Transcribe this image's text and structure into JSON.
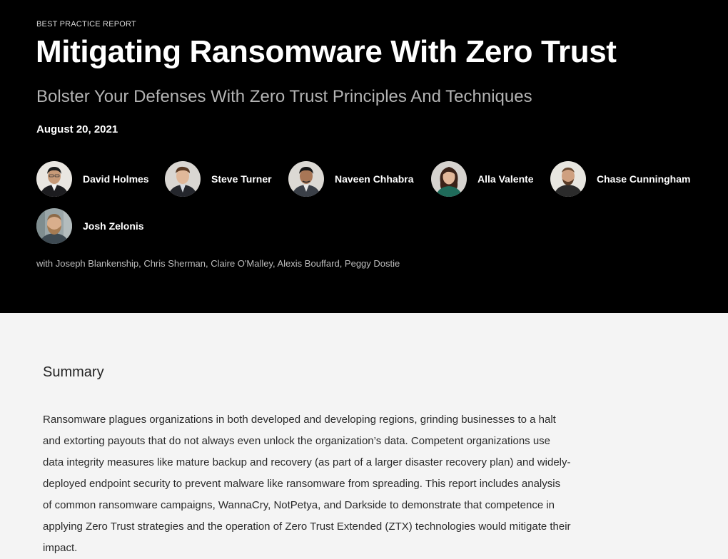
{
  "report": {
    "eyebrow": "BEST PRACTICE REPORT",
    "title": "Mitigating Ransomware With Zero Trust",
    "subtitle": "Bolster Your Defenses With Zero Trust Principles And Techniques",
    "date": "August 20, 2021"
  },
  "authors": [
    {
      "name": "David Holmes"
    },
    {
      "name": "Steve Turner"
    },
    {
      "name": "Naveen Chhabra"
    },
    {
      "name": "Alla Valente"
    },
    {
      "name": "Chase Cunningham"
    },
    {
      "name": "Josh Zelonis"
    }
  ],
  "contributors": "with Joseph Blankenship, Chris Sherman, Claire O'Malley, Alexis Bouffard, Peggy Dostie",
  "summary": {
    "heading": "Summary",
    "body": "Ransomware plagues organizations in both developed and developing regions, grinding businesses to a halt and extorting payouts that do not always even unlock the organization’s data. Competent organizations use data integrity measures like mature backup and recovery (as part of a larger disaster recovery plan) and widely-deployed endpoint security to prevent malware like ransomware from spreading. This report includes analysis of common ransomware campaigns, WannaCry, NotPetya, and Darkside to demonstrate that competence in applying Zero Trust strategies and the operation of Zero Trust Extended (ZTX) technologies would mitigate their impact."
  },
  "colors": {
    "hero_background": "#000000",
    "content_background": "#f4f4f4",
    "subtitle": "#b4b4b4"
  }
}
